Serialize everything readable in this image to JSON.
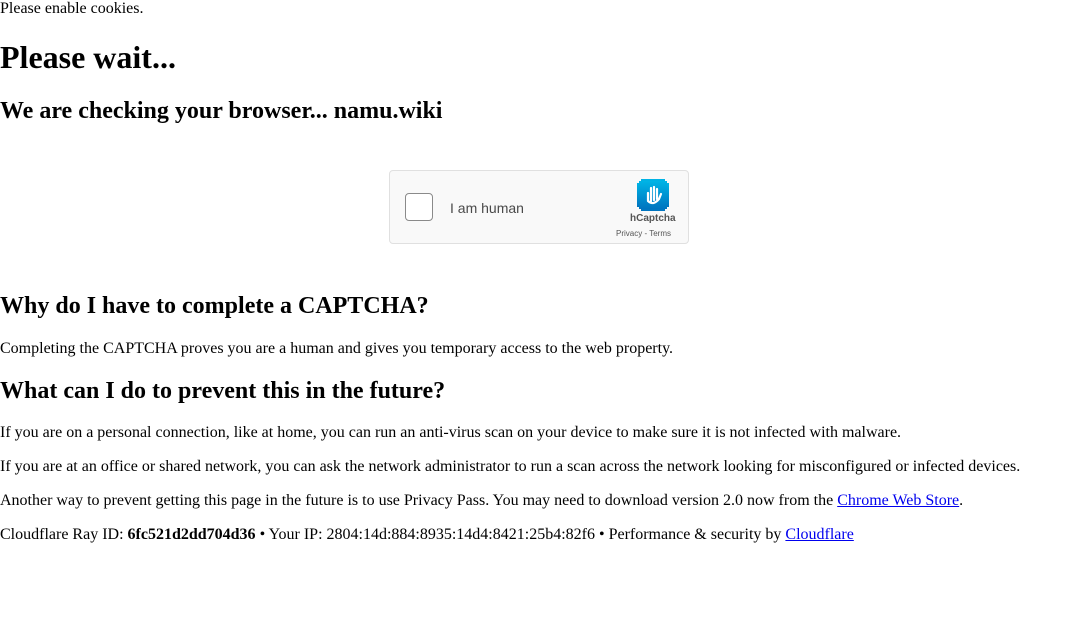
{
  "cookie_notice": "Please enable cookies.",
  "title": "Please wait...",
  "subtitle": "We are checking your browser... namu.wiki",
  "captcha": {
    "checkbox_label": "I am human",
    "brand": "hCaptcha",
    "privacy_link": "Privacy",
    "separator": " - ",
    "terms_link": "Terms"
  },
  "faq": [
    {
      "question": "Why do I have to complete a CAPTCHA?",
      "answers": [
        "Completing the CAPTCHA proves you are a human and gives you temporary access to the web property."
      ]
    },
    {
      "question": "What can I do to prevent this in the future?",
      "answers": [
        "If you are on a personal connection, like at home, you can run an anti-virus scan on your device to make sure it is not infected with malware.",
        "If you are at an office or shared network, you can ask the network administrator to run a scan across the network looking for misconfigured or infected devices."
      ]
    }
  ],
  "privacy_pass": {
    "text": "Another way to prevent getting this page in the future is to use Privacy Pass. You may need to download version 2.0 now from the ",
    "link": "Chrome Web Store",
    "end": "."
  },
  "footer": {
    "ray_label": "Cloudflare Ray ID: ",
    "ray_id": "6fc521d2dd704d36",
    "ip_text": " • Your IP: 2804:14d:884:8935:14d4:8421:25b4:82f6 • Performance & security by ",
    "cloudflare_link": "Cloudflare"
  },
  "colors": {
    "link": "#0000ee",
    "hcaptcha_logo_top": "#00b4e6",
    "hcaptcha_logo_bottom": "#0074bf"
  }
}
